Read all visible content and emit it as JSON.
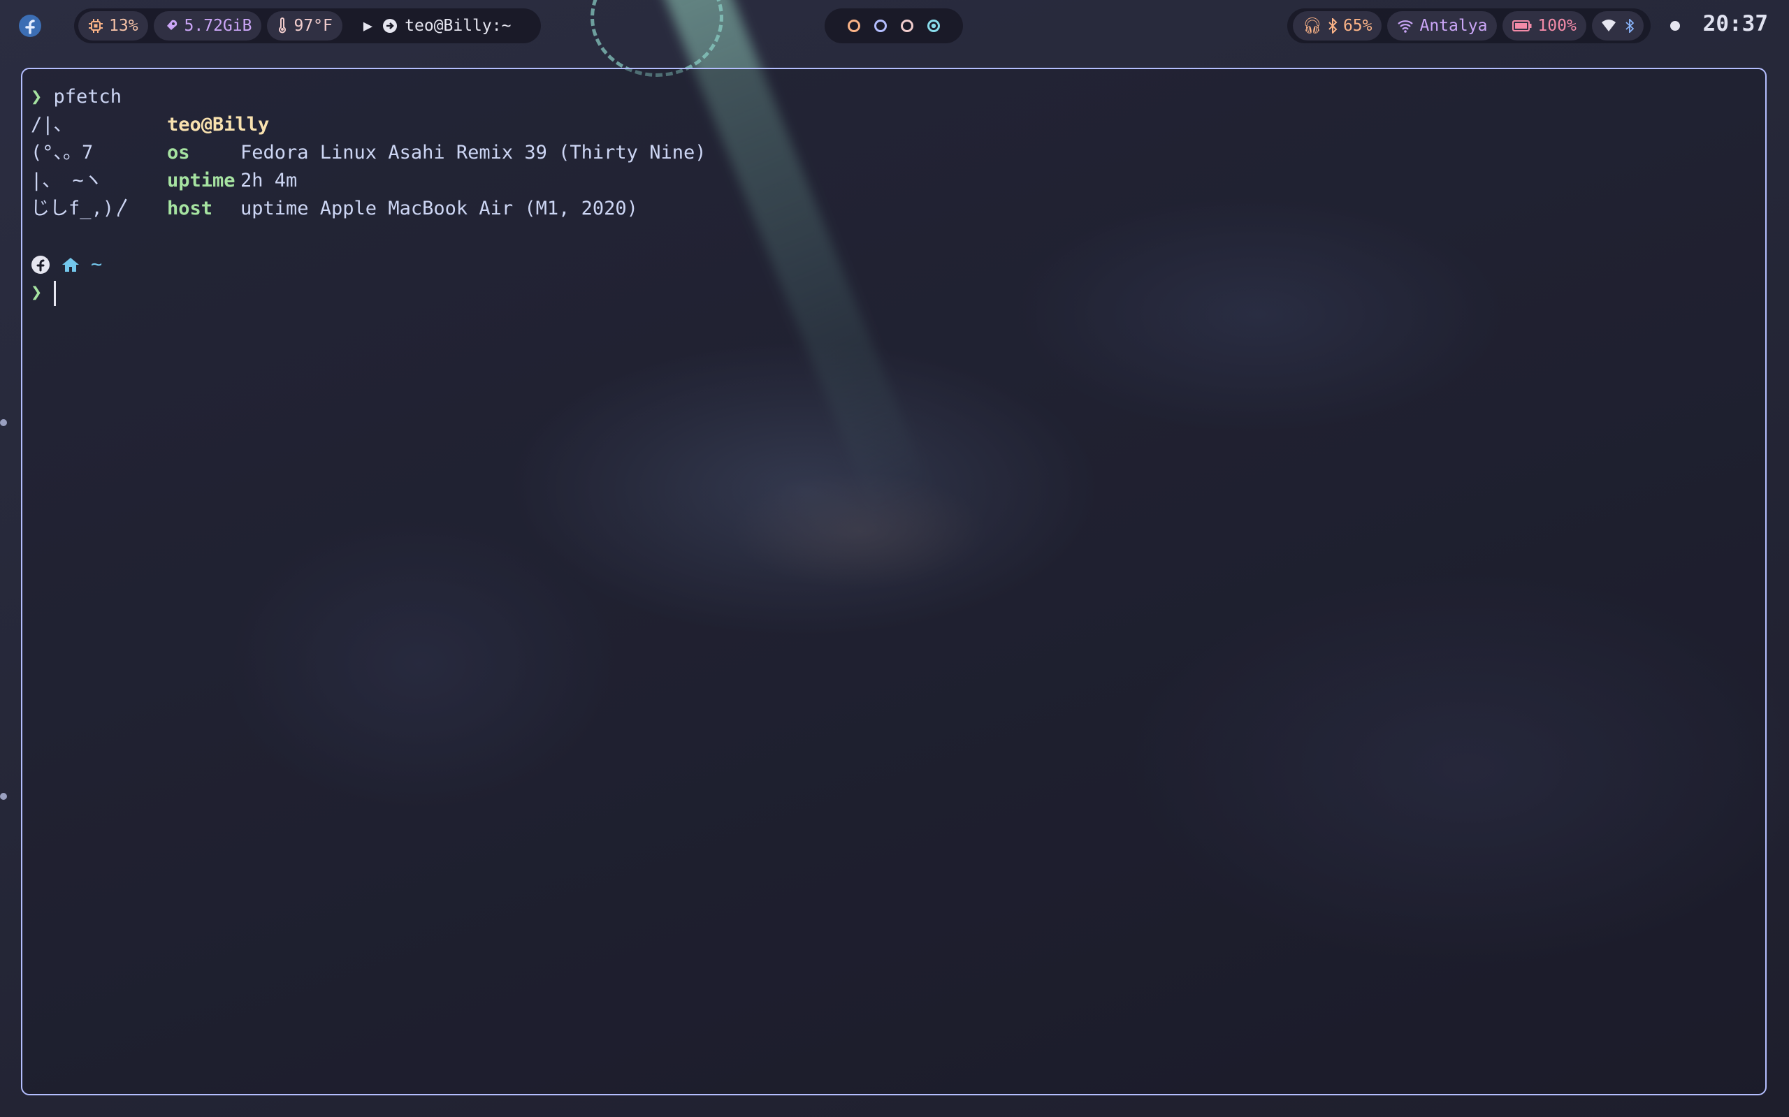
{
  "topbar": {
    "logo_icon": "fedora-logo-icon",
    "cpu": {
      "icon": "cpu-icon",
      "value": "13%"
    },
    "memory": {
      "icon": "rocket-icon",
      "value": "5.72GiB"
    },
    "temperature": {
      "icon": "thermometer-icon",
      "value": "97°F"
    },
    "window": {
      "icon": "terminal-arrow-icon",
      "title": "teo@Billy:~"
    },
    "workspaces": [
      {
        "color": "#fab387",
        "active": false
      },
      {
        "color": "#b4befe",
        "active": false
      },
      {
        "color": "#f2cdcd",
        "active": false
      },
      {
        "color": "#89dceb",
        "active": true
      }
    ],
    "audio": {
      "value": "65%"
    },
    "network": {
      "icon": "wifi-icon",
      "label": "Antalya"
    },
    "battery": {
      "icon": "battery-icon",
      "value": "100%"
    },
    "clock": "20:37"
  },
  "terminal": {
    "command": "pfetch",
    "prompt_symbol": "❯",
    "user_host": "teo@Billy",
    "art": [
      "/|、",
      "(°、。7",
      "|、 ~ヽ",
      "じしf_,)〳"
    ],
    "info": [
      {
        "key": "os",
        "value": "Fedora Linux Asahi Remix 39 (Thirty Nine)"
      },
      {
        "key": "uptime",
        "value": "2h 4m"
      },
      {
        "key": "host",
        "value": "uptime Apple MacBook Air (M1, 2020)"
      }
    ],
    "prompt_path": "~"
  },
  "colors": {
    "accent": "#b4befe",
    "green": "#a6e3a1",
    "yellow": "#f9e2af",
    "peach": "#fab387",
    "sky": "#89dceb",
    "text": "#cdd6f4"
  }
}
